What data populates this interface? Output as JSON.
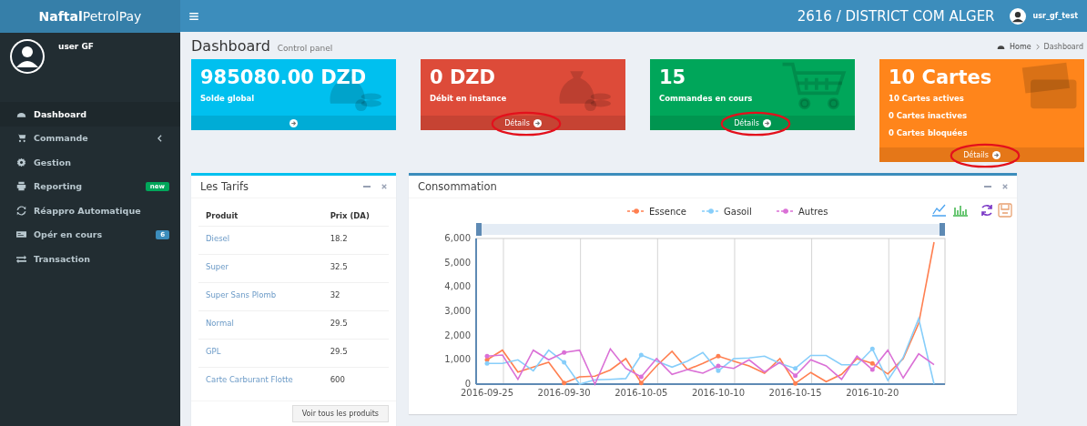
{
  "brand": {
    "bold": "Naftal",
    "light": "PetrolPay"
  },
  "header": {
    "district": "2616 / DISTRICT COM ALGER",
    "user": "usr_gf_test"
  },
  "sidebar": {
    "user": "user GF",
    "items": [
      {
        "label": "Dashboard",
        "selected": true
      },
      {
        "label": "Commande",
        "selected": false,
        "has_submenu": true
      },
      {
        "label": "Gestion",
        "selected": false
      },
      {
        "label": "Reporting",
        "selected": false,
        "badge": "new",
        "color": "#00a65a"
      },
      {
        "label": "Réappro Automatique",
        "selected": false
      },
      {
        "label": "Opér en cours",
        "selected": false,
        "badge": "6",
        "color": "#3c8dbc"
      },
      {
        "label": "Transaction",
        "selected": false
      }
    ]
  },
  "page": {
    "title": "Dashboard",
    "subtitle": "Control panel",
    "breadcrumb": [
      "Home",
      "Dashboard"
    ]
  },
  "stat_boxes": [
    {
      "value": "985080.00 DZD",
      "label": "Solde global",
      "color": "#00c0ef",
      "circled": false
    },
    {
      "value": "0 DZD",
      "label": "Débit en instance",
      "color": "#dd4b39",
      "footer": "Détails",
      "circled": true
    },
    {
      "value": "15",
      "label": "Commandes en cours",
      "color": "#00a65a",
      "footer": "Détails",
      "circled": true
    },
    {
      "value": "10 Cartes",
      "label": "10 Cartes actives",
      "lines": [
        "0 Cartes inactives",
        "0 Cartes bloquées"
      ],
      "color": "#ff851b",
      "footer": "Détails",
      "circled": true
    }
  ],
  "tarifs": {
    "title": "Les Tarifs",
    "columns": [
      "Produit",
      "Prix (DA)"
    ],
    "rows": [
      [
        "Diesel",
        "18.2"
      ],
      [
        "Super",
        "32.5"
      ],
      [
        "Super Sans Plomb",
        "32"
      ],
      [
        "Normal",
        "29.5"
      ],
      [
        "GPL",
        "29.5"
      ],
      [
        "Carte Carburant Flotte",
        "600"
      ]
    ],
    "button": "Voir tous les produits"
  },
  "consommation": {
    "title": "Consommation",
    "chart_data": {
      "type": "line",
      "grid": true,
      "legend": "top",
      "categories": [
        "2016-09-25",
        null,
        null,
        null,
        null,
        "2016-09-30",
        null,
        null,
        null,
        null,
        "2016-10-05",
        null,
        null,
        null,
        null,
        "2016-10-10",
        null,
        null,
        null,
        null,
        "2016-10-15",
        null,
        null,
        null,
        null,
        "2016-10-20",
        null,
        null,
        null,
        null
      ],
      "series": [
        {
          "name": "Essence",
          "color": "#ff7f50",
          "values": [
            1000,
            1400,
            500,
            700,
            900,
            50,
            300,
            330,
            580,
            1050,
            50,
            750,
            1350,
            600,
            850,
            1150,
            950,
            750,
            450,
            1050,
            30,
            480,
            100,
            400,
            1050,
            850,
            420,
            1050,
            2500,
            5850
          ]
        },
        {
          "name": "Gasoil",
          "color": "#87cefa",
          "values": [
            850,
            850,
            1000,
            550,
            1400,
            900,
            0,
            180,
            200,
            230,
            1200,
            950,
            700,
            950,
            1300,
            550,
            1050,
            1080,
            1150,
            850,
            650,
            1180,
            1180,
            800,
            800,
            1450,
            150,
            1100,
            2700,
            0
          ]
        },
        {
          "name": "Autres",
          "color": "#da70d6",
          "values": [
            1150,
            1200,
            200,
            1400,
            1000,
            1300,
            1400,
            0,
            1450,
            650,
            300,
            1050,
            400,
            600,
            450,
            750,
            650,
            1000,
            500,
            900,
            350,
            1000,
            750,
            200,
            1150,
            600,
            1400,
            250,
            1250,
            800
          ]
        }
      ],
      "ylim": [
        0,
        6000
      ],
      "yticks": [
        {
          "value": 0,
          "label": "0"
        },
        {
          "value": 1000,
          "label": "1,000"
        },
        {
          "value": 2000,
          "label": "2,000"
        },
        {
          "value": 3000,
          "label": "3,000"
        },
        {
          "value": 4000,
          "label": "4,000"
        },
        {
          "value": 5000,
          "label": "5,000"
        },
        {
          "value": 6000,
          "label": "6,000"
        }
      ]
    }
  }
}
